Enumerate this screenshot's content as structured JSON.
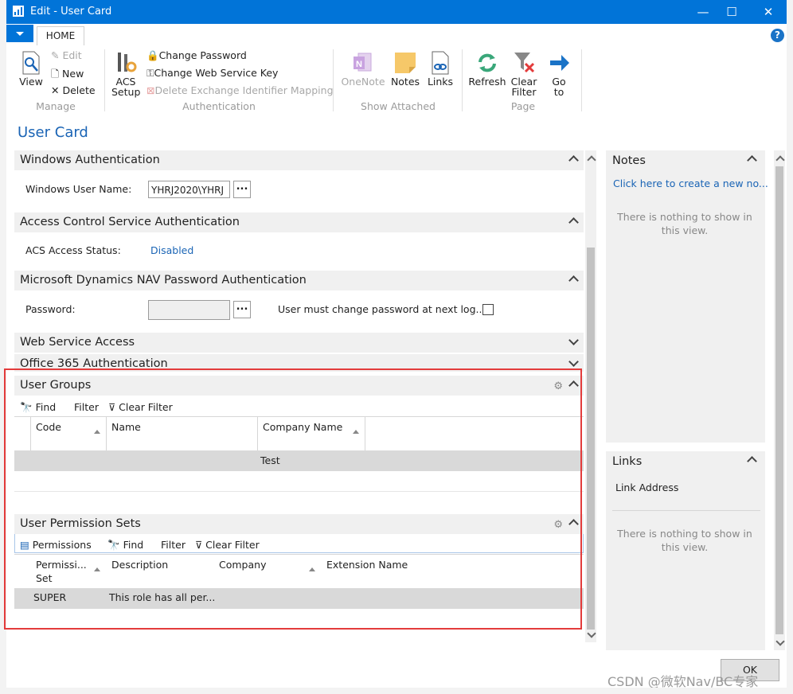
{
  "window": {
    "title": "Edit - User Card",
    "minimize": "—",
    "maximize": "☐",
    "close": "✕"
  },
  "ribbon": {
    "tab": "HOME",
    "help": "?",
    "manage": {
      "view": "View",
      "edit": "Edit",
      "new": "New",
      "delete": "Delete",
      "group": "Manage"
    },
    "authentication": {
      "acs_line1": "ACS",
      "acs_line2": "Setup",
      "change_password": "Change Password",
      "change_web_service_key": "Change Web Service Key",
      "delete_exchange": "Delete Exchange Identifier Mapping",
      "group": "Authentication"
    },
    "show_attached": {
      "onenote": "OneNote",
      "notes": "Notes",
      "links": "Links",
      "group": "Show Attached"
    },
    "page": {
      "refresh": "Refresh",
      "clear_filter_line1": "Clear",
      "clear_filter_line2": "Filter",
      "goto_line1": "Go",
      "goto_line2": "to",
      "group": "Page"
    }
  },
  "page_title": "User Card",
  "windows_auth": {
    "title": "Windows Authentication",
    "user_name_label": "Windows User Name:",
    "user_name_value": "YHRJ2020\\YHRJ",
    "lookup": "..."
  },
  "acs_auth": {
    "title": "Access Control Service Authentication",
    "status_label": "ACS Access Status:",
    "status_value": "Disabled"
  },
  "nav_password": {
    "title": "Microsoft Dynamics NAV Password Authentication",
    "password_label": "Password:",
    "lookup": "...",
    "must_change_label": "User must change password at next log..."
  },
  "web_service": {
    "title": "Web Service Access"
  },
  "office365": {
    "title": "Office 365 Authentication"
  },
  "user_groups": {
    "title": "User Groups",
    "toolbar": {
      "find": "Find",
      "filter": "Filter",
      "clear_filter": "Clear Filter"
    },
    "columns": [
      "Code",
      "Name",
      "Company Name"
    ],
    "rows": [
      {
        "code": "",
        "name": "",
        "company": "Test"
      }
    ]
  },
  "user_permission_sets": {
    "title": "User Permission Sets",
    "toolbar": {
      "permissions": "Permissions",
      "find": "Find",
      "filter": "Filter",
      "clear_filter": "Clear Filter"
    },
    "columns": [
      "Permissi...",
      "Set",
      "Description",
      "Company",
      "Extension Name"
    ],
    "rows": [
      {
        "set": "SUPER",
        "description": "This role has all per..."
      }
    ]
  },
  "notes": {
    "title": "Notes",
    "create_link": "Click here to create a new no...",
    "empty_line1": "There is nothing to show in",
    "empty_line2": "this view."
  },
  "links": {
    "title": "Links",
    "column": "Link Address",
    "empty_line1": "There is nothing to show in",
    "empty_line2": "this view."
  },
  "ok_button": "OK",
  "watermark": "CSDN @微软Nav/BC专家",
  "colors": {
    "titlebar": "#0174d8",
    "link": "#1a64b5",
    "highlight_box": "#e33b3b"
  }
}
